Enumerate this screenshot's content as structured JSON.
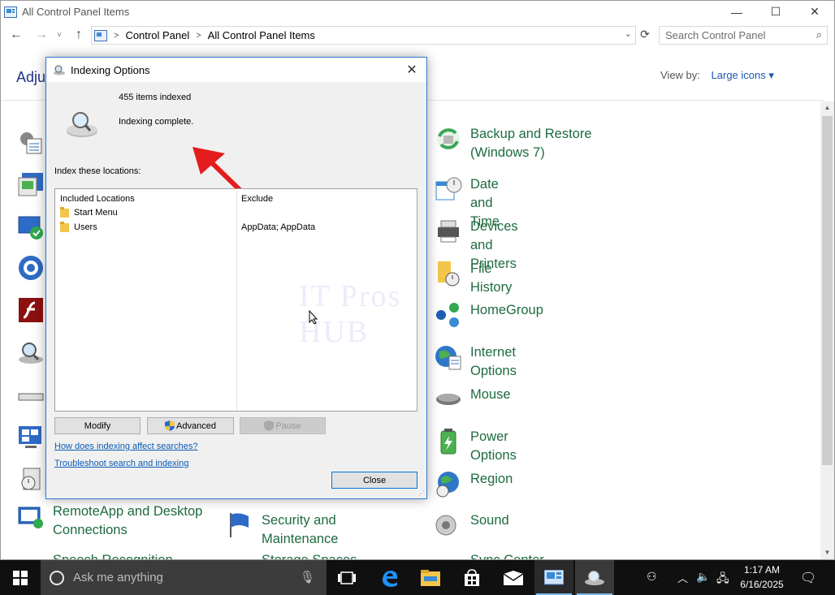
{
  "window": {
    "title": "All Control Panel Items",
    "minimize": "—",
    "maximize": "☐",
    "close": "✕"
  },
  "nav": {
    "back": "←",
    "forward": "→",
    "recent": "˅",
    "up": "↑",
    "breadcrumb": [
      "Control Panel",
      "All Control Panel Items"
    ],
    "search_placeholder": "Search Control Panel"
  },
  "header": {
    "title": "Adjus",
    "view_by_label": "View by:",
    "view_by_value": "Large icons ▾"
  },
  "items_right": [
    {
      "label": "Backup and Restore (Windows 7)",
      "icon": "backup-restore-icon"
    },
    {
      "label": "Date and Time",
      "icon": "date-time-icon"
    },
    {
      "label": "Devices and Printers",
      "icon": "devices-printers-icon"
    },
    {
      "label": "File History",
      "icon": "file-history-icon"
    },
    {
      "label": "HomeGroup",
      "icon": "homegroup-icon"
    },
    {
      "label": "Internet Options",
      "icon": "internet-options-icon"
    },
    {
      "label": "Mouse",
      "icon": "mouse-icon"
    },
    {
      "label": "Power Options",
      "icon": "power-options-icon"
    },
    {
      "label": "Region",
      "icon": "region-icon"
    },
    {
      "label": "Sound",
      "icon": "sound-icon"
    }
  ],
  "items_bottom": [
    {
      "label": "RemoteApp and Desktop Connections",
      "icon": "remoteapp-icon"
    },
    {
      "label": "Security and Maintenance",
      "icon": "security-flag-icon"
    }
  ],
  "items_cut": [
    "Speech Recognition",
    "Storage Spaces",
    "Sync Center"
  ],
  "dialog": {
    "title": "Indexing Options",
    "items_indexed": "455 items indexed",
    "status": "Indexing complete.",
    "index_label": "Index these locations:",
    "col_included": "Included Locations",
    "col_exclude": "Exclude",
    "locations": [
      {
        "name": "Start Menu",
        "exclude": ""
      },
      {
        "name": "Users",
        "exclude": "AppData; AppData"
      }
    ],
    "btn_modify": "Modify",
    "btn_advanced": "Advanced",
    "btn_pause": "Pause",
    "link_how": "How does indexing affect searches?",
    "link_troubleshoot": "Troubleshoot search and indexing",
    "btn_close": "Close",
    "watermark": "IT Pros HUB"
  },
  "taskbar": {
    "search_text": "Ask me anything",
    "time": "1:17 AM",
    "date": "6/16/2025"
  },
  "colors": {
    "link_green": "#1e6b40",
    "accent_blue": "#0078d7",
    "arrow_red": "#e51c1c",
    "taskbar": "#101010"
  }
}
